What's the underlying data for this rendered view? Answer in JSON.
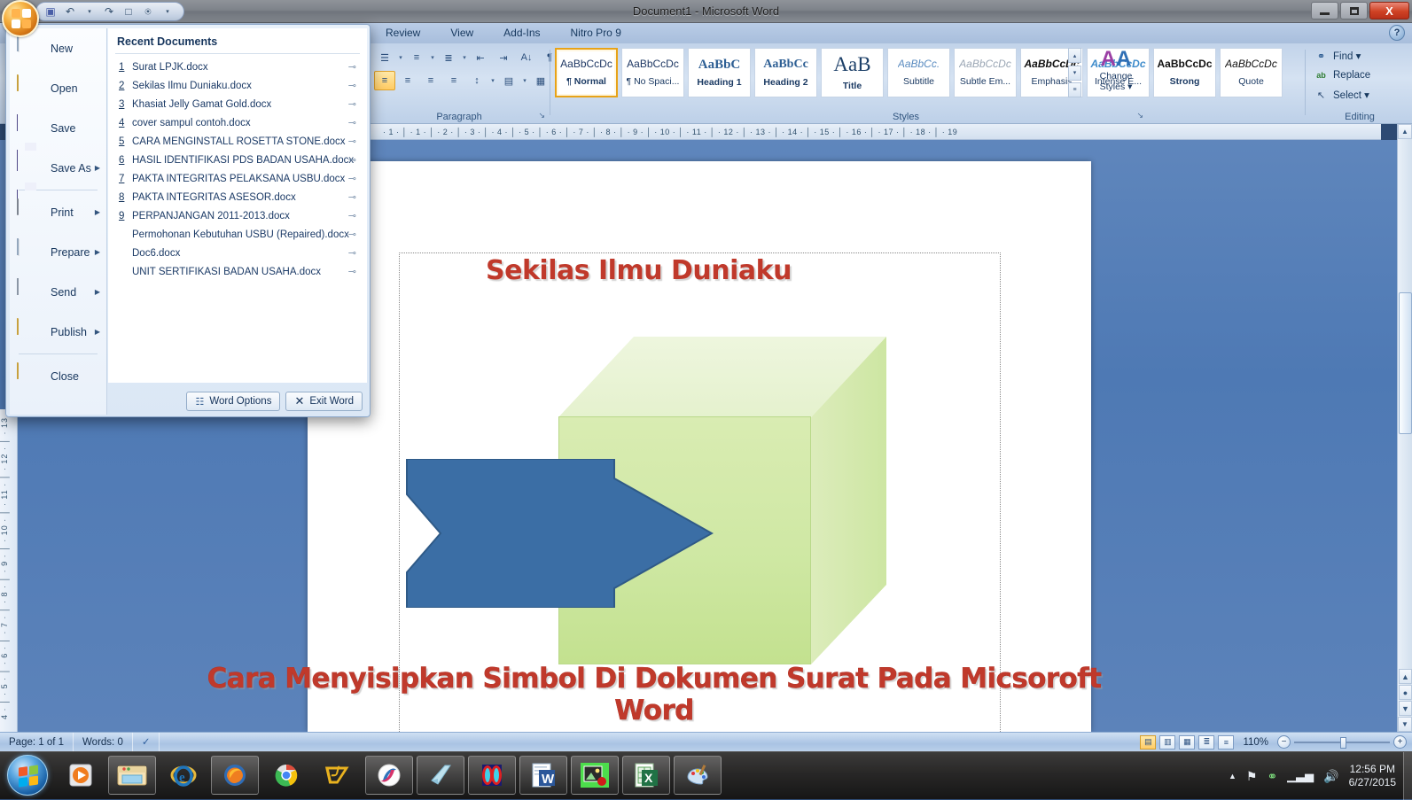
{
  "window": {
    "title": "Document1 - Microsoft Word",
    "minimize_label": "Minimize",
    "restore_label": "Restore",
    "close_label": "X"
  },
  "quick_access": {
    "items": [
      {
        "name": "save-icon",
        "glyph": "▣"
      },
      {
        "name": "undo-icon",
        "glyph": "↶"
      },
      {
        "name": "undo-dropdown-icon",
        "glyph": "▾"
      },
      {
        "name": "redo-icon",
        "glyph": "↷"
      },
      {
        "name": "new-icon",
        "glyph": "□"
      },
      {
        "name": "print-preview-icon",
        "glyph": "⌕"
      },
      {
        "name": "customize-qat-icon",
        "glyph": "▾"
      }
    ]
  },
  "ribbon": {
    "tabs": [
      "Review",
      "View",
      "Add-Ins",
      "Nitro Pro 9"
    ],
    "help_label": "?",
    "paragraph": {
      "label": "Paragraph",
      "row1": [
        {
          "name": "bullets-icon",
          "glyph": "☰"
        },
        {
          "name": "numbering-icon",
          "glyph": "≡"
        },
        {
          "name": "multilevel-list-icon",
          "glyph": "≣"
        },
        {
          "name": "decrease-indent-icon",
          "glyph": "⇤"
        },
        {
          "name": "increase-indent-icon",
          "glyph": "⇥"
        },
        {
          "name": "sort-icon",
          "glyph": "A↓"
        },
        {
          "name": "show-formatting-marks-icon",
          "glyph": "¶"
        }
      ],
      "row2": [
        {
          "name": "align-left-icon",
          "glyph": "≡"
        },
        {
          "name": "align-center-icon",
          "glyph": "≡"
        },
        {
          "name": "align-right-icon",
          "glyph": "≡"
        },
        {
          "name": "justify-icon",
          "glyph": "≡"
        },
        {
          "name": "line-spacing-icon",
          "glyph": "↕"
        },
        {
          "name": "shading-icon",
          "glyph": "▤"
        },
        {
          "name": "borders-icon",
          "glyph": "▦"
        }
      ],
      "dialog_launcher": "↘"
    },
    "styles": {
      "label": "Styles",
      "gallery": [
        {
          "sample": "AaBbCcDc",
          "name": "¶ Normal",
          "active": true,
          "style": "normal"
        },
        {
          "sample": "AaBbCcDc",
          "name": "¶ No Spaci...",
          "active": false,
          "style": "nospacing"
        },
        {
          "sample": "AaBbC",
          "name": "Heading 1",
          "active": false,
          "style": "heading1"
        },
        {
          "sample": "AaBbCc",
          "name": "Heading 2",
          "active": false,
          "style": "heading2"
        },
        {
          "sample": "AaB",
          "name": "Title",
          "active": false,
          "style": "title"
        },
        {
          "sample": "AaBbCc.",
          "name": "Subtitle",
          "active": false,
          "style": "subtitle"
        },
        {
          "sample": "AaBbCcDc",
          "name": "Subtle Em...",
          "active": false,
          "style": "subtleem"
        },
        {
          "sample": "AaBbCcDc",
          "name": "Emphasis",
          "active": false,
          "style": "emphasis"
        },
        {
          "sample": "AaBbCcDc",
          "name": "Intense E...",
          "active": false,
          "style": "intenseem"
        },
        {
          "sample": "AaBbCcDc",
          "name": "Strong",
          "active": false,
          "style": "strong"
        },
        {
          "sample": "AaBbCcDc",
          "name": "Quote",
          "active": false,
          "style": "quote"
        }
      ],
      "scroll_up": "▴",
      "scroll_down": "▾",
      "more": "≡",
      "change_styles_line1": "Change",
      "change_styles_line2": "Styles ▾",
      "dialog_launcher": "↘"
    },
    "editing": {
      "label": "Editing",
      "items": [
        {
          "label": "Find ▾",
          "icon": "binoculars-icon",
          "glyph": "⚭"
        },
        {
          "label": "Replace",
          "icon": "replace-icon",
          "glyph": "ab"
        },
        {
          "label": "Select ▾",
          "icon": "select-icon",
          "glyph": "↖"
        }
      ]
    }
  },
  "ruler": {
    "horizontal": "· 1 · │ · 1 · │ · 2 · │ · 3 · │ · 4 · │ · 5 · │ · 6 · │ · 7 · │ · 8 · │ · 9 · │ · 10 · │ · 11 · │ · 12 · │ · 13 · │ · 14 · │ · 15 · │ · 16 · │ · 17 · │ · 18 · │ · 19",
    "vertical": "4 · │ · 5 · │ · 6 · │ · 7 · │ · 8 · │ · 9 · │ · 10 · │ · 11 · │ · 12 · │ · 13"
  },
  "document": {
    "title_text": "Sekilas Ilmu Duniaku",
    "caption_text": "Cara Menyisipkan Simbol Di Dokumen Surat Pada Micsoroft Word",
    "title_color": "#c0392b",
    "cube_color": "#cfe8a4",
    "arrow_color": "#3b6ea5"
  },
  "office_menu": {
    "items": [
      {
        "label": "New",
        "underline": "N",
        "icon": "new-document-icon",
        "submenu": false
      },
      {
        "label": "Open",
        "underline": "O",
        "icon": "open-folder-icon",
        "submenu": false
      },
      {
        "label": "Save",
        "underline": "S",
        "icon": "save-disk-icon",
        "submenu": false
      },
      {
        "label": "Save As",
        "underline": "A",
        "icon": "save-as-icon",
        "submenu": true
      },
      {
        "label": "Print",
        "underline": "P",
        "icon": "printer-icon",
        "submenu": true
      },
      {
        "label": "Prepare",
        "underline": "e",
        "icon": "prepare-icon",
        "submenu": true
      },
      {
        "label": "Send",
        "underline": "d",
        "icon": "send-icon",
        "submenu": true
      },
      {
        "label": "Publish",
        "underline": "u",
        "icon": "publish-icon",
        "submenu": true
      },
      {
        "label": "Close",
        "underline": "C",
        "icon": "close-folder-icon",
        "submenu": false
      }
    ],
    "recent_title": "Recent Documents",
    "recent_documents": [
      {
        "num": "1",
        "name": "Surat LPJK.docx"
      },
      {
        "num": "2",
        "name": "Sekilas Ilmu Duniaku.docx"
      },
      {
        "num": "3",
        "name": "Khasiat Jelly Gamat Gold.docx"
      },
      {
        "num": "4",
        "name": "cover sampul contoh.docx"
      },
      {
        "num": "5",
        "name": "CARA MENGINSTALL ROSETTA STONE.docx"
      },
      {
        "num": "6",
        "name": "HASIL IDENTIFIKASI PDS BADAN USAHA.docx"
      },
      {
        "num": "7",
        "name": "PAKTA INTEGRITAS PELAKSANA USBU.docx"
      },
      {
        "num": "8",
        "name": "PAKTA INTEGRITAS ASESOR.docx"
      },
      {
        "num": "9",
        "name": "PERPANJANGAN 2011-2013.docx"
      },
      {
        "num": "",
        "name": "Permohonan Kebutuhan USBU (Repaired).docx"
      },
      {
        "num": "",
        "name": "Doc6.docx"
      },
      {
        "num": "",
        "name": "UNIT SERTIFIKASI BADAN USAHA.docx"
      }
    ],
    "pin_glyph": "⊸",
    "word_options_label": "Word Options",
    "exit_word_label": "Exit Word",
    "exit_icon_glyph": "✕"
  },
  "status_bar": {
    "page_label": "Page: 1 of 1",
    "words_label": "Words: 0",
    "proofing_icon": "spell-check-icon",
    "views": [
      {
        "name": "print-layout-view",
        "glyph": "▤",
        "active": true
      },
      {
        "name": "full-screen-reading-view",
        "glyph": "▥",
        "active": false
      },
      {
        "name": "web-layout-view",
        "glyph": "▦",
        "active": false
      },
      {
        "name": "outline-view",
        "glyph": "≣",
        "active": false
      },
      {
        "name": "draft-view",
        "glyph": "≡",
        "active": false
      }
    ],
    "zoom_label": "110%",
    "zoom_out": "−",
    "zoom_in": "+"
  },
  "taskbar": {
    "start_label": "Start",
    "items": [
      {
        "name": "taskbar-windows-media-player",
        "framed": false
      },
      {
        "name": "taskbar-windows-explorer",
        "framed": true
      },
      {
        "name": "taskbar-internet-explorer",
        "framed": false
      },
      {
        "name": "taskbar-mozilla-firefox",
        "framed": true
      },
      {
        "name": "taskbar-google-chrome",
        "framed": false
      },
      {
        "name": "taskbar-winamp",
        "framed": false
      },
      {
        "name": "taskbar-maxthon-browser",
        "framed": true
      },
      {
        "name": "taskbar-baidu-browser",
        "framed": true
      },
      {
        "name": "taskbar-notepad",
        "framed": true
      },
      {
        "name": "taskbar-idm-downloader",
        "framed": true
      },
      {
        "name": "taskbar-microsoft-word",
        "framed": true
      },
      {
        "name": "taskbar-photo-editor",
        "framed": true
      },
      {
        "name": "taskbar-microsoft-excel",
        "framed": true
      },
      {
        "name": "taskbar-paint",
        "framed": true
      }
    ],
    "tray": {
      "show_hidden_icons": "▲",
      "flag_icon": "⚑",
      "network_icon": "❖",
      "signal_icon": "▃",
      "volume_icon": "ᴴ",
      "time": "12:56 PM",
      "date": "6/27/2015"
    }
  }
}
